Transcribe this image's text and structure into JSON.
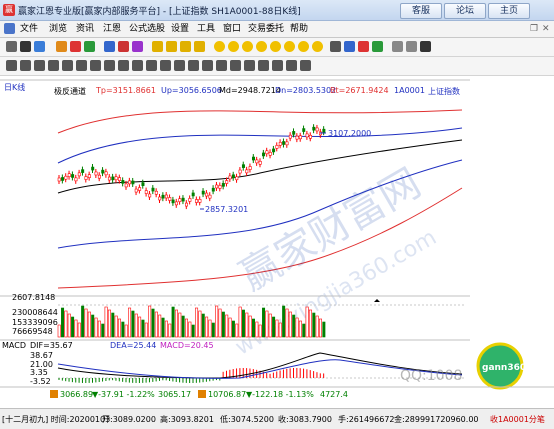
{
  "window": {
    "title": "赢家江恩专业版[赢家内部服务平台] - [上证指数  SH1A0001-88日K线]",
    "buttons": [
      "客服",
      "论坛",
      "主页"
    ]
  },
  "menu": [
    "文件",
    "浏览",
    "资讯",
    "江恩",
    "公式选股",
    "设置",
    "工具",
    "窗口",
    "交易委托",
    "帮助"
  ],
  "chart": {
    "period_label": "日K线",
    "indicator_name": "极反通道",
    "top_line": "Tp=3151.8661",
    "up_line": "Up=3056.6506",
    "mid_line": "Md=2948.7214",
    "dn_line": "Dn=2803.5302",
    "bt_line": "Bt=2671.9424",
    "symbol": "1A0001",
    "symbol_name": "上证指数",
    "high_marker": "3107.2000",
    "low_marker": "2857.3201",
    "volume_max": "2607.8148",
    "volume_ticks": [
      "230008644",
      "153339096",
      "76669548"
    ],
    "macd_label": "MACD",
    "dif": "DIF=35.67",
    "dea": "DEA=25.44",
    "macd": "MACD=20.45",
    "macd_ticks": [
      "38.67",
      "21.00",
      "3.35",
      "-3.52"
    ],
    "watermark_site": "www.yingjia360.com",
    "qq_watermark": "QQ:1008",
    "logo_text": "gann360"
  },
  "status": {
    "date": "[十二月初九] 时间:20200103",
    "open": "开:3089.0200",
    "high": "高:3093.8201",
    "low": "低:3074.5200",
    "close": "收:3083.7900",
    "vol": "手:261496672",
    "amount": "金:289991720960.00",
    "tick_label": "收1A0001分笔"
  },
  "ticker": {
    "sh_value": "3066.89",
    "sh_change": "▼-37.91 -1.22%",
    "sh_amount": "3065.17",
    "sz_value": "10706.87",
    "sz_change": "▼-122.18 -1.13%",
    "sz_amount": "4727.4"
  },
  "colors": {
    "up": "#ff0000",
    "down": "#008000",
    "channel_red": "#e03030",
    "channel_blue": "#2030c0"
  }
}
